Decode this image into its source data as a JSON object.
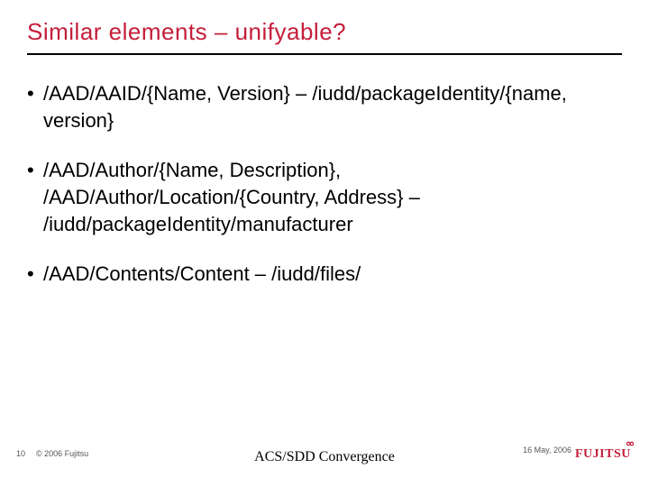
{
  "title": "Similar elements – unifyable?",
  "bullets": [
    "/AAD/AAID/{Name, Version} – /iudd/packageIdentity/{name, version}",
    "/AAD/Author/{Name, Description}, /AAD/Author/Location/{Country, Address} – /iudd/packageIdentity/manufacturer",
    "/AAD/Contents/Content – /iudd/files/"
  ],
  "footer": {
    "page_number": "10",
    "copyright": "© 2006 Fujitsu",
    "center": "ACS/SDD Convergence",
    "date": "16 May, 2006",
    "logo_text": "FUJITSU"
  }
}
